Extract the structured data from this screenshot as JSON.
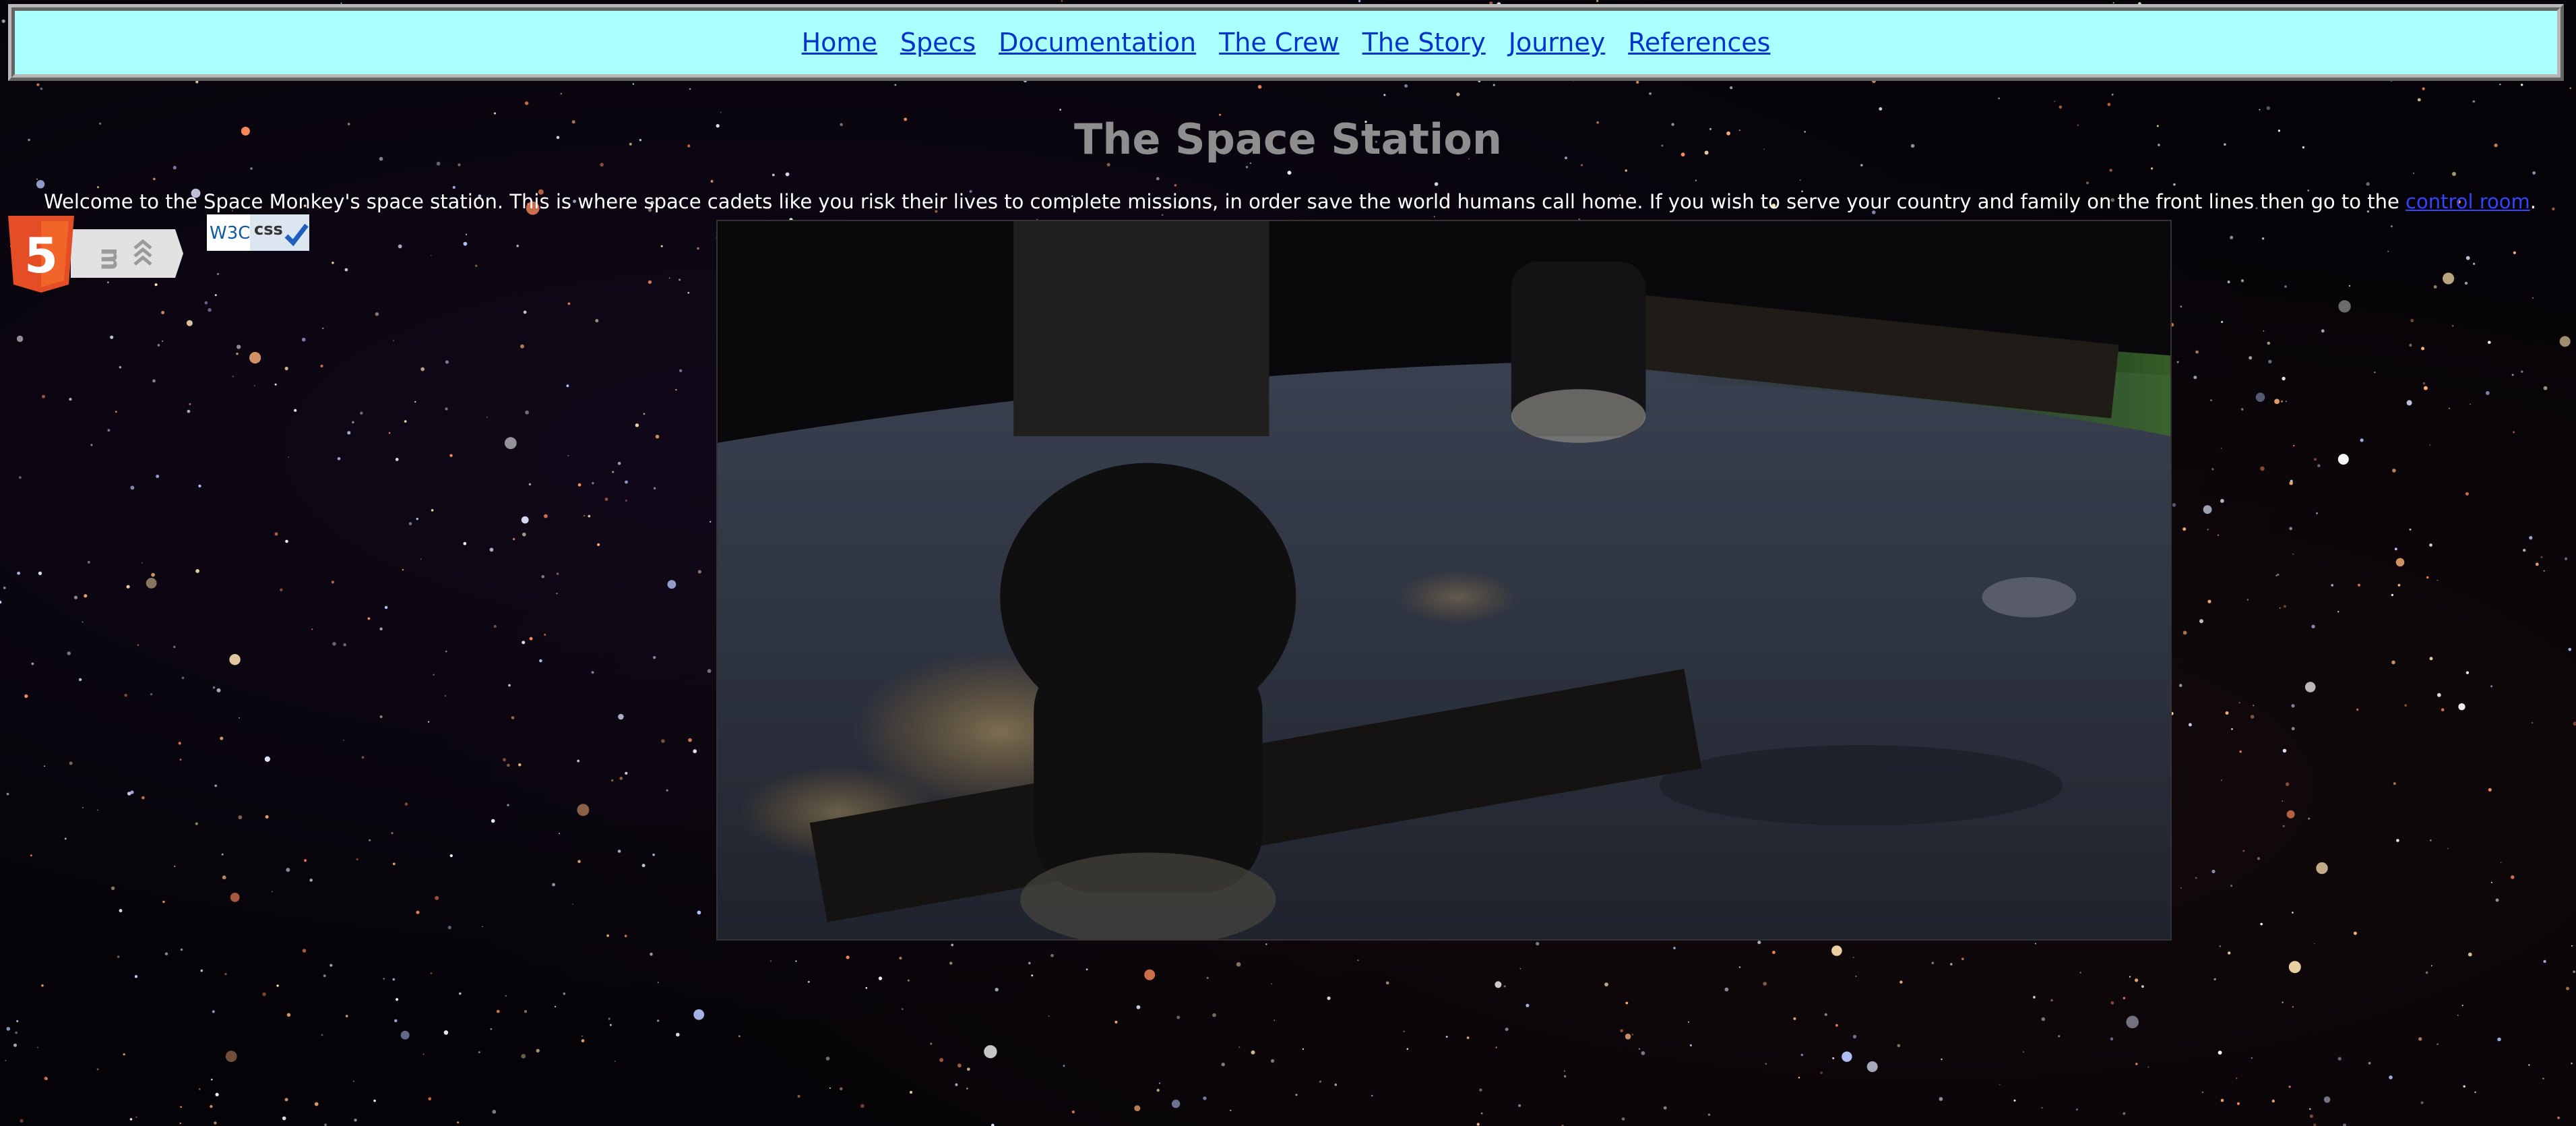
{
  "nav": {
    "items": [
      {
        "label": "Home"
      },
      {
        "label": "Specs"
      },
      {
        "label": "Documentation"
      },
      {
        "label": "The Crew"
      },
      {
        "label": "The Story"
      },
      {
        "label": "Journey"
      },
      {
        "label": "References"
      }
    ]
  },
  "main": {
    "title": "The Space Station",
    "intro_text": "Welcome to the Space Monkey's space station. This is where space cadets like you risk their lives to complete missions, in order save the world humans call home. If you wish to serve your country and family on the front lines then go to the ",
    "intro_link": "control room",
    "intro_end": "."
  },
  "badges": {
    "html5_icon": "html5-logo-icon",
    "css_badge_w3c": "W3C",
    "css_badge_css": "css"
  },
  "image": {
    "subject": "space-station-earth-photo"
  },
  "colors": {
    "nav_bg": "#aaffff",
    "link": "#0033cc",
    "title": "#8e8e8e",
    "body_text": "#ffffff",
    "page_bg": "#050308",
    "html5_orange": "#e44d26"
  }
}
